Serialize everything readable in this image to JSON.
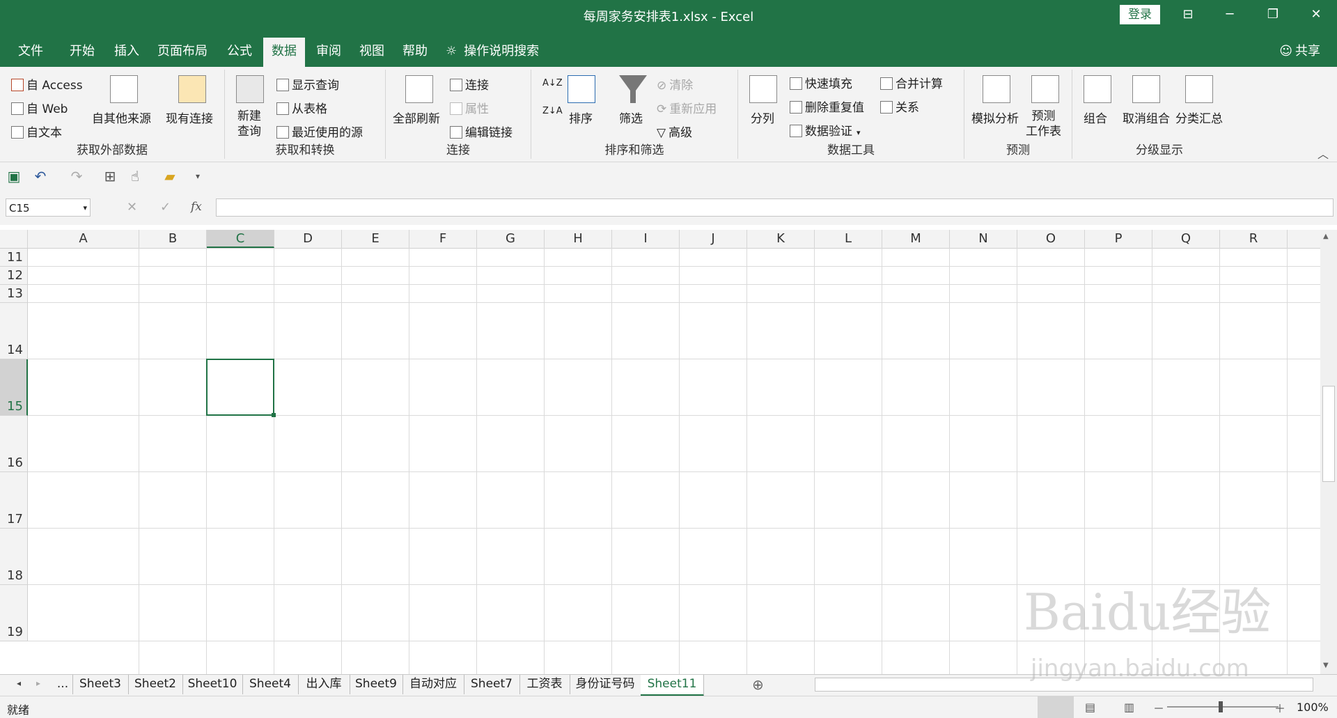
{
  "title": "每周家务安排表1.xlsx  -  Excel",
  "title_bar": {
    "login": "登录",
    "minimize": "─",
    "restore": "❐",
    "close": "✕",
    "ribbon_display": "⊟"
  },
  "menu": {
    "tabs": [
      "文件",
      "开始",
      "插入",
      "页面布局",
      "公式",
      "数据",
      "审阅",
      "视图",
      "帮助"
    ],
    "active": "数据",
    "tell_me": "操作说明搜索",
    "share": "共享"
  },
  "ribbon": {
    "get_external": {
      "label": "获取外部数据",
      "access": "自 Access",
      "web": "自 Web",
      "text": "自文本",
      "other": "自其他来源",
      "existing": "现有连接"
    },
    "get_transform": {
      "label": "获取和转换",
      "new_query_1": "新建",
      "new_query_2": "查询",
      "show_query": "显示查询",
      "from_table": "从表格",
      "recent": "最近使用的源"
    },
    "connections": {
      "label": "连接",
      "refresh_all": "全部刷新",
      "connections": "连接",
      "properties": "属性",
      "edit_links": "编辑链接"
    },
    "sort_filter": {
      "label": "排序和筛选",
      "sort": "排序",
      "filter": "筛选",
      "clear": "清除",
      "reapply": "重新应用",
      "advanced": "高级"
    },
    "data_tools": {
      "label": "数据工具",
      "text_to_columns": "分列",
      "flash_fill": "快速填充",
      "remove_dup": "删除重复值",
      "validation": "数据验证",
      "consolidate": "合并计算",
      "relationships": "关系"
    },
    "forecast": {
      "label": "预测",
      "what_if": "模拟分析",
      "forecast_1": "预测",
      "forecast_2": "工作表"
    },
    "outline": {
      "label": "分级显示",
      "group": "组合",
      "ungroup": "取消组合",
      "subtotal": "分类汇总"
    }
  },
  "formula_bar": {
    "name_box": "C15",
    "fx": "fx",
    "cancel": "✕",
    "enter": "✓",
    "value": ""
  },
  "columns": [
    "A",
    "B",
    "C",
    "D",
    "E",
    "F",
    "G",
    "H",
    "I",
    "J",
    "K",
    "L",
    "M",
    "N",
    "O",
    "P",
    "Q",
    "R"
  ],
  "rows": [
    "11",
    "12",
    "13",
    "14",
    "15",
    "16",
    "17",
    "18",
    "19"
  ],
  "selected_cell": {
    "col": "C",
    "row": "15"
  },
  "sheet_tabs": [
    "...",
    "Sheet3",
    "Sheet2",
    "Sheet10",
    "Sheet4",
    "出入库",
    "Sheet9",
    "自动对应",
    "Sheet7",
    "工资表",
    "身份证号码",
    "Sheet11"
  ],
  "active_sheet": "Sheet11",
  "status": {
    "ready": "就绪",
    "zoom": "100%",
    "zoom_minus": "－",
    "zoom_plus": "＋"
  },
  "watermark": {
    "main": "Baidu经验",
    "url": "jingyan.baidu.com"
  },
  "colors": {
    "accent": "#217346",
    "ribbon_bg": "#f3f3f3"
  }
}
